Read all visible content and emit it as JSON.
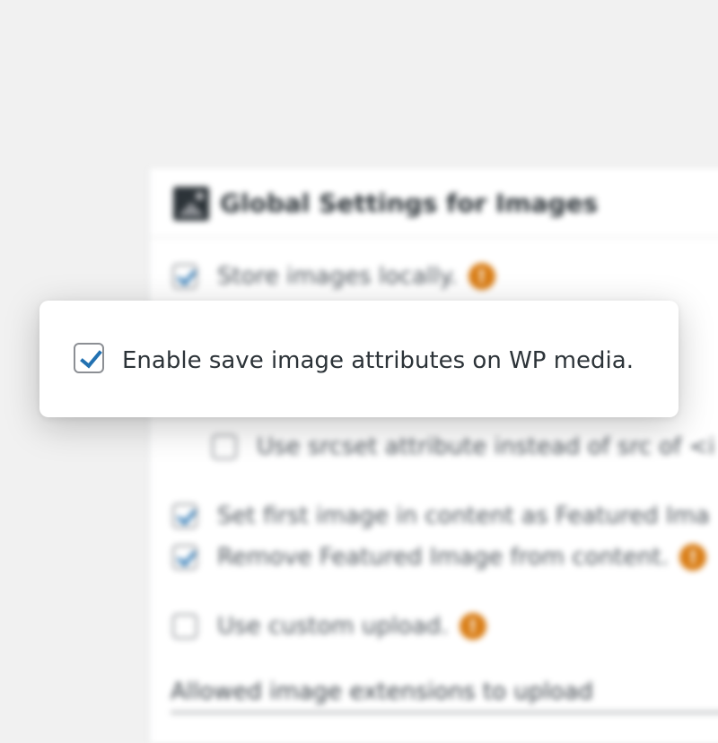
{
  "panel": {
    "title": "Global Settings for Images",
    "title_icon": "image-icon",
    "options": [
      {
        "label": "Store images locally.",
        "checked": true,
        "help": true
      },
      {
        "label": "Use srcset attribute instead of src of <i",
        "checked": false,
        "help": false
      },
      {
        "label": "Set first image in content as Featured Ima",
        "checked": true,
        "help": false
      },
      {
        "label": "Remove Featured Image from content.",
        "checked": true,
        "help": true
      },
      {
        "label": "Use custom upload.",
        "checked": false,
        "help": true
      }
    ],
    "help_glyph": "!",
    "extensions_label": "Allowed image extensions to upload"
  },
  "popup": {
    "label": "Enable save image attributes on WP media.",
    "checked": true
  },
  "colors": {
    "accent": "#2271b1",
    "help": "#d97d15",
    "background": "#f1f1f1"
  }
}
